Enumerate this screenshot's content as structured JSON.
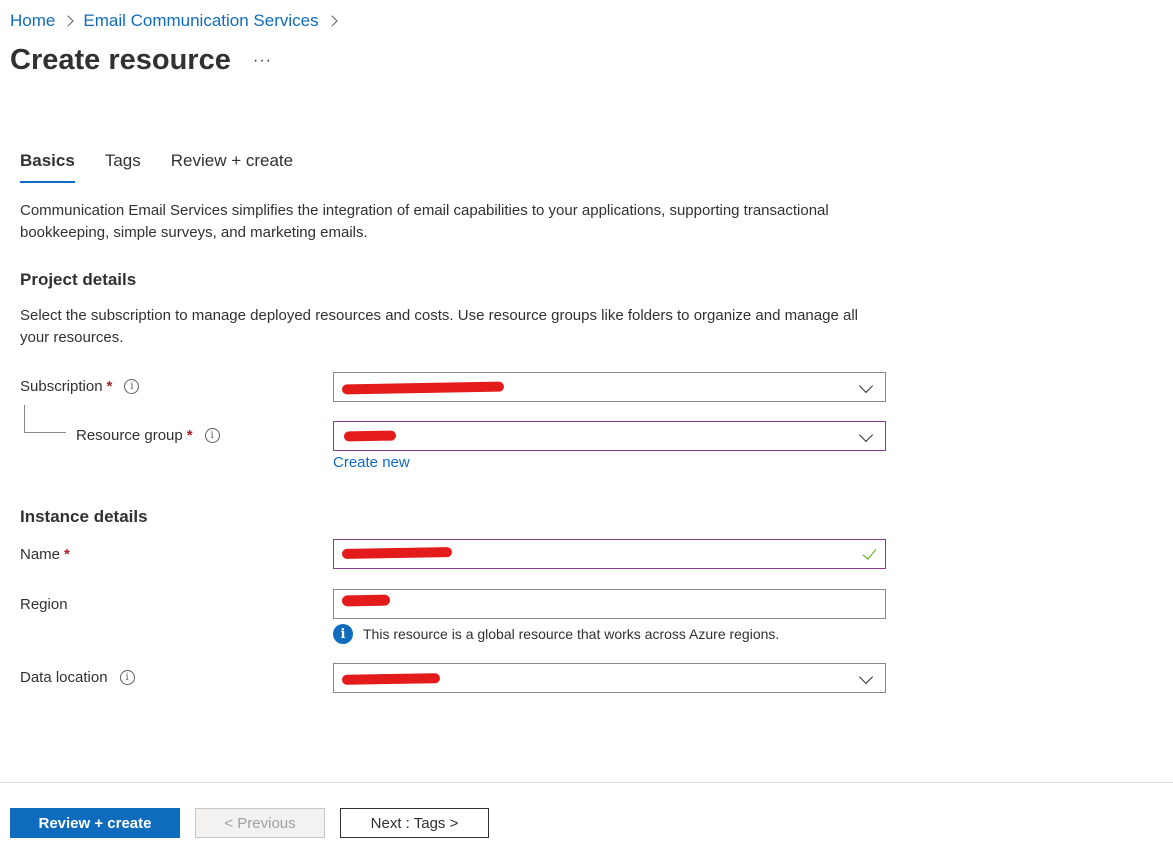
{
  "breadcrumb": {
    "home": "Home",
    "service": "Email Communication Services"
  },
  "page": {
    "title": "Create resource",
    "more": "···"
  },
  "tabs": [
    {
      "label": "Basics"
    },
    {
      "label": "Tags"
    },
    {
      "label": "Review + create"
    }
  ],
  "intro": "Communication Email Services simplifies the integration of email capabilities to your applications, supporting transactional bookkeeping, simple surveys, and marketing emails.",
  "project": {
    "title": "Project details",
    "description": "Select the subscription to manage deployed resources and costs. Use resource groups like folders to organize and manage all your resources.",
    "subscription_label": "Subscription",
    "resource_group_label": "Resource group",
    "create_new": "Create new"
  },
  "instance": {
    "title": "Instance details",
    "name_label": "Name",
    "region_label": "Region",
    "region_info": "This resource is a global resource that works across Azure regions.",
    "data_location_label": "Data location"
  },
  "footer": {
    "review_create": "Review + create",
    "previous": "< Previous",
    "next": "Next : Tags >"
  },
  "colors": {
    "accent": "#0f6cbd",
    "required": "#a4262c",
    "focus_border": "#8a3a8e",
    "redaction": "#e31b1b",
    "valid": "#57a300"
  }
}
